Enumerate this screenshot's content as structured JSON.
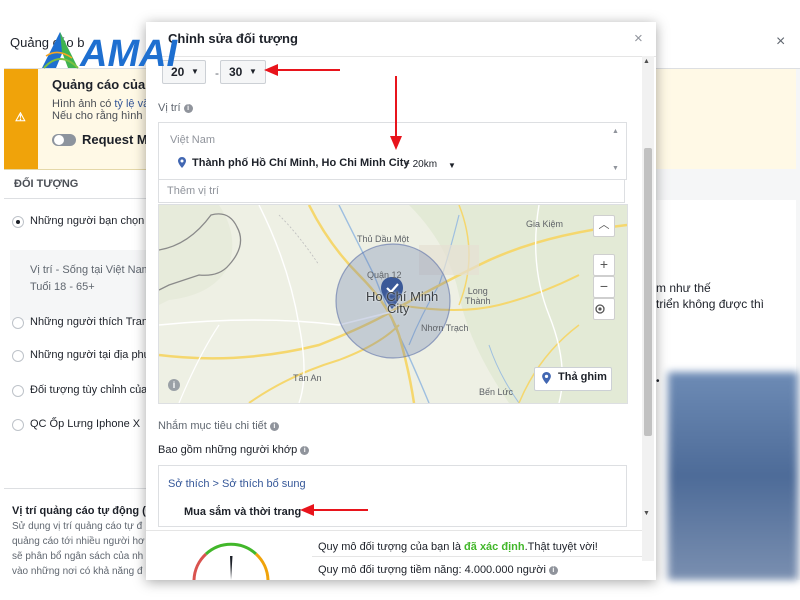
{
  "background": {
    "title": "Quảng cáo b",
    "close_icon": "×",
    "warning": {
      "icon": "⚠",
      "title": "Quảng cáo của b",
      "line1_prefix": "Hình ảnh có ",
      "line1_link": "tỷ lệ văn",
      "line2": "Nếu cho rằng hình ả",
      "toggle_label": "Request Ma"
    },
    "audience_header": "ĐỐI TƯỢNG",
    "audience_options": [
      "Những người bạn chọn th",
      "Những người thích Trang",
      "Những người tại địa phươ",
      "Đối tượng tùy chỉnh của b",
      "QC Ốp Lưng Iphone X"
    ],
    "audience_detail_1": "Vị trí - Sống tại Việt Nam:",
    "audience_detail_2": "Tuổi 18 - 65+",
    "placement_title": "Vị trí quảng cáo tự động (Đ",
    "placement_lines": [
      "Sử dụng vị trí quảng cáo tự đ",
      "quảng cáo tới nhiều người hơ",
      "sẽ phân bổ ngân sách của nh",
      "vào những nơi có khả năng đ"
    ],
    "right_text_1": "m như thế",
    "right_text_2": "triển không được thì",
    "right_dot": "•"
  },
  "modal": {
    "title": "Chỉnh sửa đối tượng",
    "close_icon": "×",
    "age_min": "20",
    "age_max": "30",
    "age_separator": "-",
    "location_label": "Vị trí",
    "location_country": "Việt Nam",
    "location_city": "Thành phố Hồ Chí Minh, Ho Chi Minh City",
    "location_radius": "+ 20km",
    "add_location_placeholder": "Thêm vị trí",
    "map": {
      "labels": {
        "gia_kiem": "Gia Kiệm",
        "thu_dau_mot": "Thủ Dầu Một",
        "quan_12": "Quận 12",
        "city_line1": "Ho Chí Minh",
        "city_line2": "City",
        "long_thanh": "Long\nThành",
        "nhon_trach": "Nhơn Trạch",
        "tan_an": "Tân An",
        "ben_luc": "Bến Lức"
      },
      "zoom_in": "+",
      "zoom_out": "−",
      "collapse": "︿",
      "drop_pin": "Thả ghim",
      "info": "i"
    },
    "detailed_targeting_label": "Nhắm mục tiêu chi tiết",
    "include_label": "Bao gồm những người khớp",
    "interest_breadcrumb": "Sở thích > Sở thích bổ sung",
    "interest_item": "Mua sắm và thời trang",
    "size_prefix": "Quy mô đối tượng của bạn là ",
    "size_status": "đã xác định",
    "size_suffix": ".Thật tuyệt vời!",
    "potential_reach": "Quy mô đối tượng tiềm năng: 4.000.000 người"
  },
  "logo": {
    "text": "AMAI"
  },
  "colors": {
    "warning": "#f0a30a",
    "link": "#365899",
    "good": "#42b72a",
    "arrow": "#e8141c",
    "map_circle": "#5b6fa8",
    "logo_blue": "#1e6fd0"
  }
}
